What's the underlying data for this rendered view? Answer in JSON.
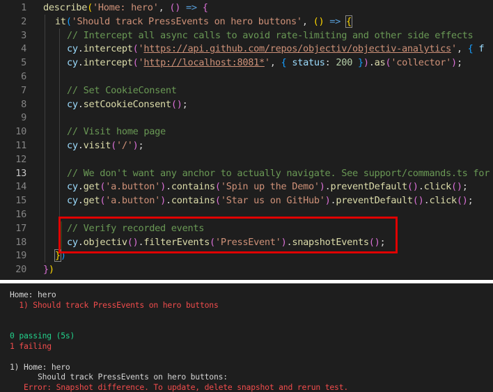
{
  "editor": {
    "active_line": 13,
    "lines": [
      {
        "n": 1,
        "guides": 0,
        "tokens": [
          [
            "fn",
            "describe"
          ],
          [
            "b1",
            "("
          ],
          [
            "str",
            "'Home: hero'"
          ],
          [
            "plain",
            ", "
          ],
          [
            "b2",
            "()"
          ],
          [
            "plain",
            " "
          ],
          [
            "arrow",
            "=>"
          ],
          [
            "plain",
            " "
          ],
          [
            "b2",
            "{"
          ]
        ]
      },
      {
        "n": 2,
        "guides": 1,
        "tokens": [
          [
            "fn",
            "it"
          ],
          [
            "b3",
            "("
          ],
          [
            "str",
            "'Should track PressEvents on hero buttons'"
          ],
          [
            "plain",
            ", "
          ],
          [
            "b1",
            "()"
          ],
          [
            "plain",
            " "
          ],
          [
            "arrow",
            "=>"
          ],
          [
            "plain",
            " "
          ],
          [
            "bm",
            "{"
          ]
        ]
      },
      {
        "n": 3,
        "guides": 2,
        "tokens": [
          [
            "comment",
            "// Intercept all async calls to avoid rate-limiting and other side effects"
          ]
        ]
      },
      {
        "n": 4,
        "guides": 2,
        "tokens": [
          [
            "ident",
            "cy"
          ],
          [
            "plain",
            "."
          ],
          [
            "fn",
            "intercept"
          ],
          [
            "b2",
            "("
          ],
          [
            "str",
            "'"
          ],
          [
            "url",
            "https://api.github.com/repos/objectiv/objectiv-analytics"
          ],
          [
            "str",
            "'"
          ],
          [
            "plain",
            ", "
          ],
          [
            "b3",
            "{"
          ],
          [
            "plain",
            " "
          ],
          [
            "ident",
            "f"
          ]
        ]
      },
      {
        "n": 5,
        "guides": 2,
        "tokens": [
          [
            "ident",
            "cy"
          ],
          [
            "plain",
            "."
          ],
          [
            "fn",
            "intercept"
          ],
          [
            "b2",
            "("
          ],
          [
            "str",
            "'"
          ],
          [
            "url",
            "http://localhost:8081*"
          ],
          [
            "str",
            "'"
          ],
          [
            "plain",
            ", "
          ],
          [
            "b3",
            "{"
          ],
          [
            "plain",
            " "
          ],
          [
            "ident",
            "status"
          ],
          [
            "plain",
            ": "
          ],
          [
            "num",
            "200"
          ],
          [
            "plain",
            " "
          ],
          [
            "b3",
            "}"
          ],
          [
            "b2",
            ")"
          ],
          [
            "plain",
            "."
          ],
          [
            "fn",
            "as"
          ],
          [
            "b2",
            "("
          ],
          [
            "str",
            "'collector'"
          ],
          [
            "b2",
            ")"
          ],
          [
            "plain",
            ";"
          ]
        ]
      },
      {
        "n": 6,
        "guides": 2,
        "tokens": []
      },
      {
        "n": 7,
        "guides": 2,
        "tokens": [
          [
            "comment",
            "// Set CookieConsent"
          ]
        ]
      },
      {
        "n": 8,
        "guides": 2,
        "tokens": [
          [
            "ident",
            "cy"
          ],
          [
            "plain",
            "."
          ],
          [
            "fn",
            "setCookieConsent"
          ],
          [
            "b2",
            "()"
          ],
          [
            "plain",
            ";"
          ]
        ]
      },
      {
        "n": 9,
        "guides": 2,
        "tokens": []
      },
      {
        "n": 10,
        "guides": 2,
        "tokens": [
          [
            "comment",
            "// Visit home page"
          ]
        ]
      },
      {
        "n": 11,
        "guides": 2,
        "tokens": [
          [
            "ident",
            "cy"
          ],
          [
            "plain",
            "."
          ],
          [
            "fn",
            "visit"
          ],
          [
            "b2",
            "("
          ],
          [
            "str",
            "'/'"
          ],
          [
            "b2",
            ")"
          ],
          [
            "plain",
            ";"
          ]
        ]
      },
      {
        "n": 12,
        "guides": 2,
        "tokens": []
      },
      {
        "n": 13,
        "guides": 2,
        "tokens": [
          [
            "comment",
            "// We don't want any anchor to actually navigate. See support/commands.ts for"
          ]
        ]
      },
      {
        "n": 14,
        "guides": 2,
        "tokens": [
          [
            "ident",
            "cy"
          ],
          [
            "plain",
            "."
          ],
          [
            "fn",
            "get"
          ],
          [
            "b2",
            "("
          ],
          [
            "str",
            "'a.button'"
          ],
          [
            "b2",
            ")"
          ],
          [
            "plain",
            "."
          ],
          [
            "fn",
            "contains"
          ],
          [
            "b2",
            "("
          ],
          [
            "str",
            "'Spin up the Demo'"
          ],
          [
            "b2",
            ")"
          ],
          [
            "plain",
            "."
          ],
          [
            "fn",
            "preventDefault"
          ],
          [
            "b2",
            "()"
          ],
          [
            "plain",
            "."
          ],
          [
            "fn",
            "click"
          ],
          [
            "b2",
            "()"
          ],
          [
            "plain",
            ";"
          ]
        ]
      },
      {
        "n": 15,
        "guides": 2,
        "tokens": [
          [
            "ident",
            "cy"
          ],
          [
            "plain",
            "."
          ],
          [
            "fn",
            "get"
          ],
          [
            "b2",
            "("
          ],
          [
            "str",
            "'a.button'"
          ],
          [
            "b2",
            ")"
          ],
          [
            "plain",
            "."
          ],
          [
            "fn",
            "contains"
          ],
          [
            "b2",
            "("
          ],
          [
            "str",
            "'Star us on GitHub'"
          ],
          [
            "b2",
            ")"
          ],
          [
            "plain",
            "."
          ],
          [
            "fn",
            "preventDefault"
          ],
          [
            "b2",
            "()"
          ],
          [
            "plain",
            "."
          ],
          [
            "fn",
            "click"
          ],
          [
            "b2",
            "()"
          ],
          [
            "plain",
            ";"
          ]
        ]
      },
      {
        "n": 16,
        "guides": 2,
        "tokens": []
      },
      {
        "n": 17,
        "guides": 2,
        "tokens": [
          [
            "comment",
            "// Verify recorded events"
          ]
        ]
      },
      {
        "n": 18,
        "guides": 2,
        "tokens": [
          [
            "ident",
            "cy"
          ],
          [
            "plain",
            "."
          ],
          [
            "fn",
            "objectiv"
          ],
          [
            "b2",
            "()"
          ],
          [
            "plain",
            "."
          ],
          [
            "fn",
            "filterEvents"
          ],
          [
            "b2",
            "("
          ],
          [
            "str",
            "'PressEvent'"
          ],
          [
            "b2",
            ")"
          ],
          [
            "plain",
            "."
          ],
          [
            "fn",
            "snapshotEvents"
          ],
          [
            "b2",
            "()"
          ],
          [
            "plain",
            ";"
          ]
        ]
      },
      {
        "n": 19,
        "guides": 1,
        "tokens": [
          [
            "bm",
            "}"
          ],
          [
            "b3",
            ")"
          ]
        ]
      },
      {
        "n": 20,
        "guides": 0,
        "tokens": [
          [
            "b2",
            "}"
          ],
          [
            "b1",
            ")"
          ]
        ]
      }
    ]
  },
  "terminal": {
    "lines": [
      {
        "text": "Home: hero",
        "color": "#d4d4d4",
        "indent": 0
      },
      {
        "text": "  1) Should track PressEvents on hero buttons",
        "color": "#f14c4c",
        "indent": 0
      },
      {
        "text": "",
        "color": "#d4d4d4",
        "indent": 0
      },
      {
        "text": "",
        "color": "#d4d4d4",
        "indent": 0
      },
      {
        "text": "0 passing (5s)",
        "color": "#23d18b",
        "indent": 0
      },
      {
        "text": "1 failing",
        "color": "#f14c4c",
        "indent": 0
      },
      {
        "text": "",
        "color": "#d4d4d4",
        "indent": 0
      },
      {
        "text": "1) Home: hero",
        "color": "#d4d4d4",
        "indent": 0
      },
      {
        "text": "      Should track PressEvents on hero buttons:",
        "color": "#d4d4d4",
        "indent": 0
      },
      {
        "text": "   Error: Snapshot difference. To update, delete snapshot and rerun test.",
        "color": "#f14c4c",
        "indent": 0
      }
    ]
  },
  "colors": {
    "editor_bg": "#1e1e1e",
    "highlight_border": "#e00000",
    "comment": "#6a9955",
    "string": "#ce9178",
    "function": "#dcdcaa",
    "identifier": "#9cdcfe"
  }
}
